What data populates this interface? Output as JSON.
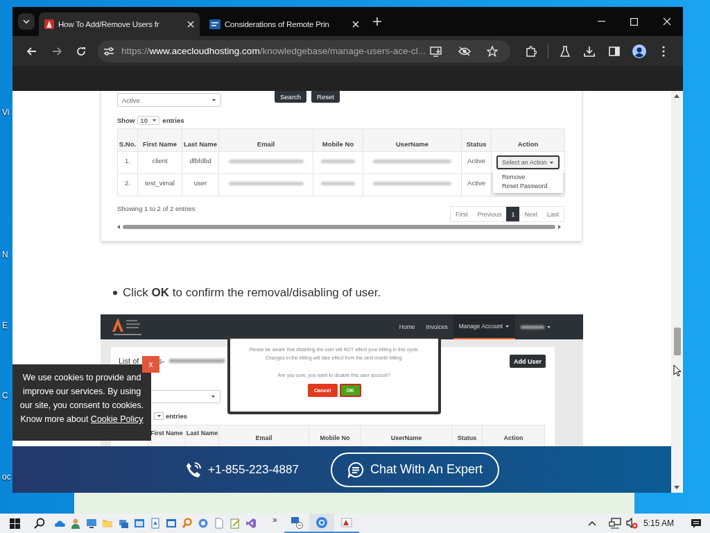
{
  "desktop": {
    "icons": [
      {
        "label": "Vi"
      },
      {
        "label": "N"
      },
      {
        "label": "E"
      },
      {
        "label": "C"
      },
      {
        "label": "oc"
      }
    ]
  },
  "browser": {
    "tabs": [
      {
        "title": "How To Add/Remove Users fr",
        "kind": "ace",
        "selected": true
      },
      {
        "title": "Considerations of Remote Prin",
        "kind": "doc",
        "selected": false
      }
    ],
    "url": {
      "scheme": "https://",
      "host": "www.acecloudhosting.com",
      "path": "/knowledgebase/manage-users-ace-cl..."
    }
  },
  "screenshot_1": {
    "status_select": "Active",
    "search_button": "Search",
    "reset_button": "Reset",
    "show_label": "Show",
    "page_length": "10",
    "entries_label": "entries",
    "columns": [
      "S.No.",
      "First Name",
      "Last Name",
      "Email",
      "Mobile No",
      "UserName",
      "Status",
      "Action"
    ],
    "rows": [
      {
        "sno": "1.",
        "first_name": "client",
        "last_name": "dfbfdbd",
        "status": "Active"
      },
      {
        "sno": "2.",
        "first_name": "test_vimal",
        "last_name": "user",
        "status": "Active"
      }
    ],
    "action_button": "Select an Action",
    "action_menu": [
      "Remove",
      "Reset Password"
    ],
    "info": "Showing 1 to 2 of 2 entries",
    "pagination": [
      {
        "label": "First",
        "selected": false
      },
      {
        "label": "Previous",
        "selected": false
      },
      {
        "label": "1",
        "selected": true
      },
      {
        "label": "Next",
        "selected": false
      },
      {
        "label": "Last",
        "selected": false
      }
    ]
  },
  "bullet": "Click **OK** to confirm the removal/disabling of user.",
  "screenshot_2": {
    "nav": [
      {
        "kind": "link",
        "label": "Home",
        "selected": false,
        "dropdown": false
      },
      {
        "kind": "link",
        "label": "Invoices",
        "selected": false,
        "dropdown": false
      },
      {
        "kind": "link",
        "label": "Manage Account",
        "selected": true,
        "dropdown": true
      },
      {
        "kind": "redacted",
        "selected": false,
        "dropdown": true
      }
    ],
    "heading": "List of",
    "heading_tail": "s-",
    "add_user_button": "Add User",
    "entries_label": "entries",
    "columns": [
      "First Name",
      "Last Name",
      "Email",
      "Mobile No",
      "UserName",
      "Status",
      "Action"
    ],
    "dialog": {
      "message": "Please be aware that disabling the user will NOT effect your billing in this cycle. Changes in the billing will take effect from the next month billing.",
      "question": "Are you sure, you want to disable this user account?",
      "cancel_button": "Cancel",
      "ok_button": "OK"
    }
  },
  "cookie_banner": {
    "text": "We use cookies to provide and improve our services. By using our site, you consent to cookies. Know more about",
    "link": "Cookie Policy",
    "close": "x"
  },
  "contact_bar": {
    "phone": "+1-855-223-4887",
    "chat_button": "Chat With An Expert"
  },
  "taskbar": {
    "overflow": "»",
    "clock": "5:15 AM"
  }
}
